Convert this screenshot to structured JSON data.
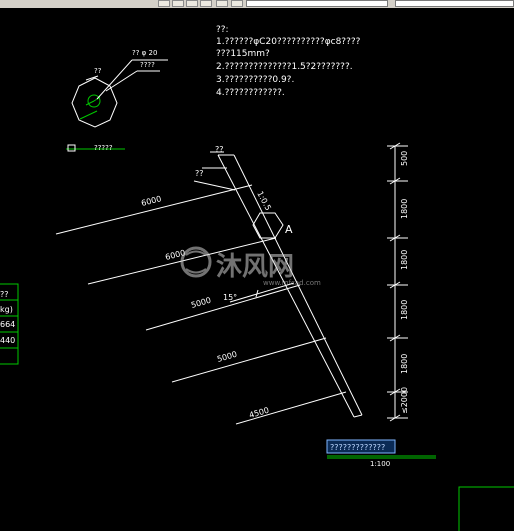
{
  "notes": {
    "heading": "??:",
    "lines": [
      "1.??????φC20??????????φc8????",
      "???115mm?",
      "2.??????????????1.5?2???????.",
      "3.??????????0.9?.",
      "4.????????????."
    ]
  },
  "detail": {
    "top_label": "?? φ 20",
    "small_label": "??",
    "side_label": "????"
  },
  "legend": {
    "text": "?????"
  },
  "elevation": {
    "top_label": "??",
    "left_label": "??",
    "slope_label": "1:0.5",
    "detail_marker": "A",
    "angle_label": "15°",
    "anchors": [
      "6000",
      "6000",
      "5000",
      "5000",
      "4500"
    ]
  },
  "dimensions": [
    "500",
    "1800",
    "1800",
    "1800",
    "1800",
    "≤2000"
  ],
  "table": {
    "rows": [
      "??",
      "kg)",
      "664",
      "440"
    ]
  },
  "title_block": {
    "title": "?????????????",
    "scale": "1:100"
  },
  "watermark": {
    "text": "沐风网",
    "url": "www.mfcad.com"
  },
  "colors": {
    "background": "#000000",
    "lines": "#ffffff",
    "green": "#00c800",
    "title": "#7fb6ff"
  }
}
